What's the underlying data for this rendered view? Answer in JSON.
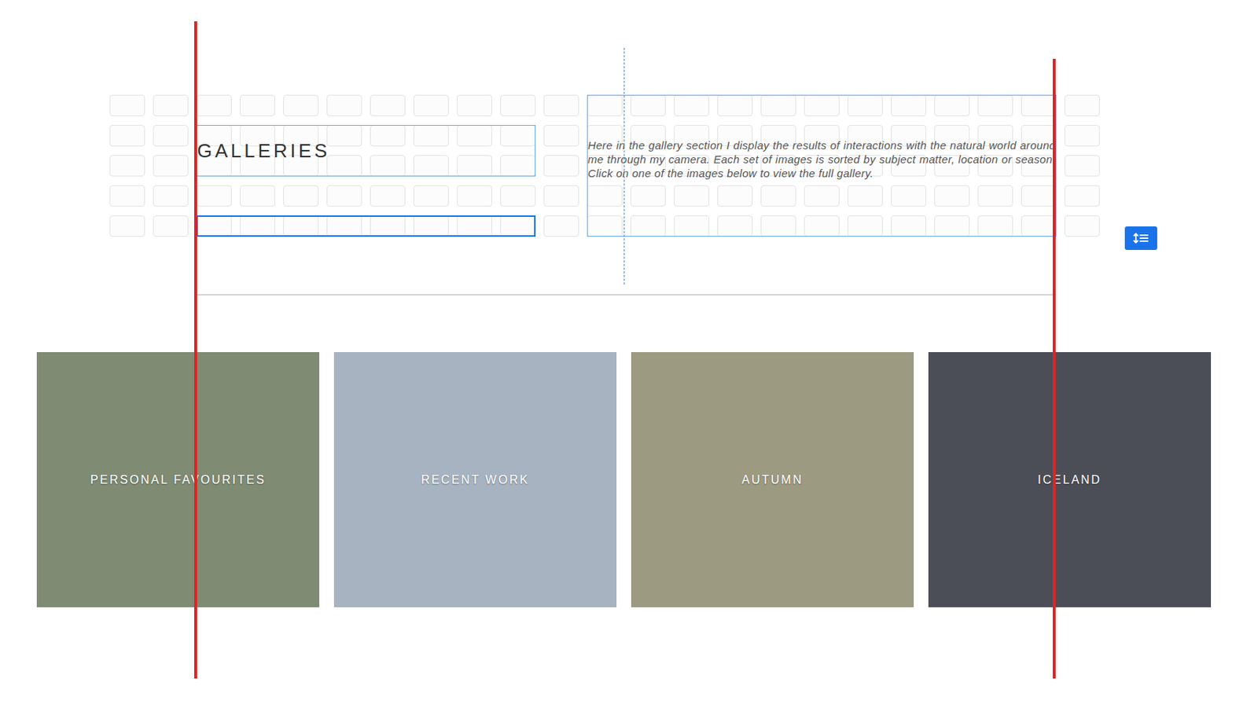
{
  "section": {
    "heading": "GALLERIES",
    "description": "Here in the gallery section I display the results of interactions with the natural world around me through my camera. Each set of images is sorted by subject matter, location or season. Click on one of the images below to view the full gallery."
  },
  "galleries": [
    {
      "label": "PERSONAL FAVOURITES",
      "color": "#7f8b72"
    },
    {
      "label": "RECENT WORK",
      "color": "#a7b3c1"
    },
    {
      "label": "AUTUMN",
      "color": "#9c9a80"
    },
    {
      "label": "ICELAND",
      "color": "#4b4e57"
    }
  ]
}
